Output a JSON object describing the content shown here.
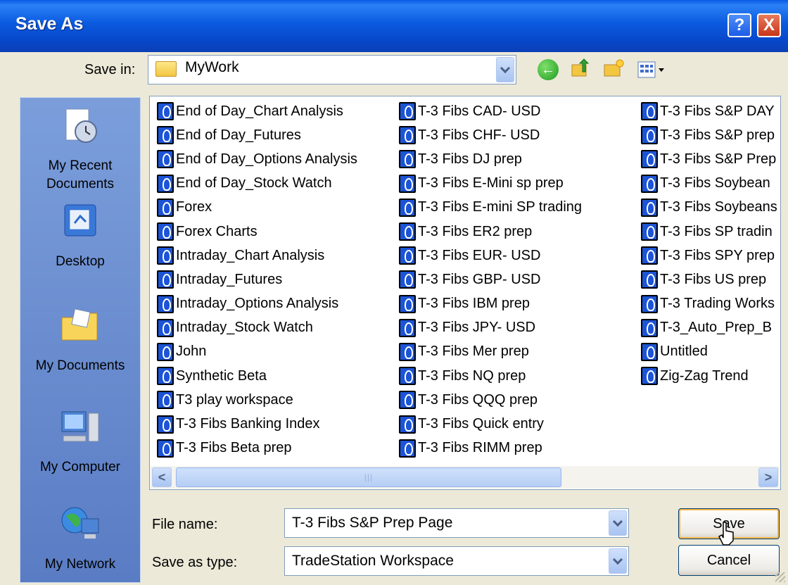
{
  "window": {
    "title": "Save As",
    "help_label": "?",
    "close_label": "X"
  },
  "toolbar": {
    "save_in_label": "Save in:",
    "save_in_value": "MyWork",
    "back_icon": "back-icon",
    "up_icon": "up-folder-icon",
    "new_folder_icon": "new-folder-icon",
    "views_icon": "views-menu-icon"
  },
  "places": [
    {
      "label_line1": "My Recent",
      "label_line2": "Documents"
    },
    {
      "label_line1": "Desktop",
      "label_line2": ""
    },
    {
      "label_line1": "My Documents",
      "label_line2": ""
    },
    {
      "label_line1": "My Computer",
      "label_line2": ""
    },
    {
      "label_line1": "My Network",
      "label_line2": ""
    }
  ],
  "files": {
    "col1": [
      "End of Day_Chart Analysis",
      "End of Day_Futures",
      "End of Day_Options Analysis",
      "End of Day_Stock Watch",
      "Forex",
      "Forex Charts",
      "Intraday_Chart Analysis",
      "Intraday_Futures",
      "Intraday_Options Analysis",
      "Intraday_Stock Watch",
      "John",
      "Synthetic Beta",
      "T3 play workspace",
      "T-3 Fibs Banking Index",
      "T-3 Fibs Beta prep"
    ],
    "col2": [
      "T-3 Fibs CAD- USD",
      "T-3 Fibs CHF- USD",
      "T-3 Fibs DJ prep",
      "T-3 Fibs E-Mini sp prep",
      "T-3 Fibs E-mini SP trading",
      "T-3 Fibs ER2  prep",
      "T-3 Fibs EUR- USD",
      "T-3 Fibs GBP- USD",
      "T-3 Fibs IBM  prep",
      "T-3 Fibs JPY- USD",
      "T-3 Fibs Mer  prep",
      "T-3 Fibs NQ prep",
      "T-3 Fibs QQQ  prep",
      "T-3 Fibs Quick entry",
      "T-3 Fibs RIMM  prep"
    ],
    "col3": [
      "T-3 Fibs S&P DAY",
      "T-3 Fibs S&P prep",
      "T-3 Fibs S&P Prep",
      "T-3 Fibs Soybean",
      "T-3 Fibs Soybeans",
      "T-3 Fibs SP tradin",
      "T-3 Fibs SPY prep",
      "T-3 Fibs US prep",
      "T-3 Trading Works",
      "T-3_Auto_Prep_B",
      "Untitled",
      "Zig-Zag Trend"
    ]
  },
  "scrollbar": {
    "left_arrow": "<",
    "right_arrow": ">",
    "thumb_grip": "|||"
  },
  "form": {
    "file_name_label": "File name:",
    "file_name_value": "T-3 Fibs S&P Prep Page",
    "save_type_label": "Save as type:",
    "save_type_value": "TradeStation Workspace"
  },
  "buttons": {
    "save": "Save",
    "cancel": "Cancel"
  }
}
